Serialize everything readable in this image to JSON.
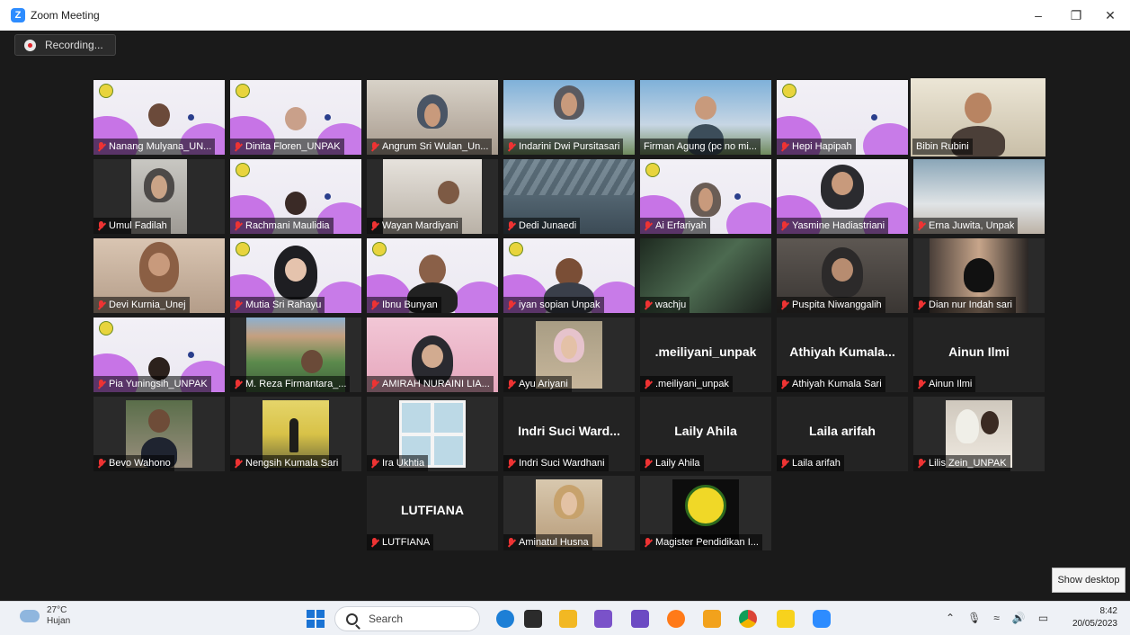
{
  "window": {
    "title": "Zoom Meeting",
    "minimize_icon": "minimize-icon",
    "maximize_icon": "restore-icon",
    "close_icon": "close-icon"
  },
  "recording": {
    "label": "Recording..."
  },
  "participants": [
    {
      "name": "Nanang Mulyana_UN...",
      "muted": true
    },
    {
      "name": "Dinita Floren_UNPAK",
      "muted": true
    },
    {
      "name": "Angrum Sri Wulan_Un...",
      "muted": true
    },
    {
      "name": "Indarini Dwi Pursitasari",
      "muted": true
    },
    {
      "name": "Firman Agung (pc no mi...",
      "muted": false
    },
    {
      "name": "Hepi Hapipah",
      "muted": true
    },
    {
      "name": "Bibin Rubini",
      "muted": false,
      "active_speaker": true
    },
    {
      "name": "Umul Fadilah",
      "muted": true
    },
    {
      "name": "Rachmani Maulidia",
      "muted": true
    },
    {
      "name": "Wayan Mardiyani",
      "muted": true
    },
    {
      "name": "Dedi Junaedi",
      "muted": true
    },
    {
      "name": "Ai Erfariyah",
      "muted": true
    },
    {
      "name": "Yasmine Hadiastriani",
      "muted": true
    },
    {
      "name": "Erna Juwita, Unpak",
      "muted": true
    },
    {
      "name": "Devi Kurnia_Unej",
      "muted": true
    },
    {
      "name": "Mutia Sri Rahayu",
      "muted": true
    },
    {
      "name": "Ibnu Bunyan",
      "muted": true
    },
    {
      "name": "iyan sopian Unpak",
      "muted": true
    },
    {
      "name": "wachju",
      "muted": true
    },
    {
      "name": "Puspita Niwanggalih",
      "muted": true
    },
    {
      "name": "Dian nur Indah sari",
      "muted": true
    },
    {
      "name": "Pia Yuningsih_UNPAK",
      "muted": true
    },
    {
      "name": "M. Reza Firmantara_...",
      "muted": true
    },
    {
      "name": "AMIRAH NURAINI LIA...",
      "muted": true
    },
    {
      "name": "Ayu Ariyani",
      "muted": true
    },
    {
      "name": ".meiliyani_unpak",
      "muted": true,
      "display_name": ".meiliyani_unpak"
    },
    {
      "name": "Athiyah Kumala Sari",
      "muted": true,
      "display_name": "Athiyah  Kumala..."
    },
    {
      "name": "Ainun Ilmi",
      "muted": true,
      "display_name": "Ainun Ilmi"
    },
    {
      "name": "Bevo Wahono",
      "muted": true
    },
    {
      "name": "Nengsih Kumala Sari",
      "muted": true
    },
    {
      "name": "Ira Ukhtia",
      "muted": true
    },
    {
      "name": "Indri Suci Wardhani",
      "muted": true,
      "display_name": "Indri  Suci  Ward..."
    },
    {
      "name": "Laily Ahila",
      "muted": true,
      "display_name": "Laily Ahila"
    },
    {
      "name": "Laila arifah",
      "muted": true,
      "display_name": "Laila arifah"
    },
    {
      "name": "Lilis Zein_UNPAK",
      "muted": true
    },
    {
      "name": "LUTFIANA",
      "muted": true,
      "display_name": "LUTFIANA"
    },
    {
      "name": "Aminatul Husna",
      "muted": true
    },
    {
      "name": "Magister Pendidikan I...",
      "muted": true
    }
  ],
  "show_desktop": {
    "label": "Show desktop"
  },
  "taskbar": {
    "weather_temp": "27°C",
    "weather_desc": "Hujan",
    "search_placeholder": "Search",
    "time": "8:42",
    "date": "20/05/2023",
    "apps": [
      "bing-chat-icon",
      "task-view-icon",
      "file-explorer-icon",
      "photos-icon",
      "photo-editor-icon",
      "firefox-icon",
      "network-app-icon",
      "chrome-icon",
      "sticky-notes-icon",
      "zoom-icon"
    ]
  },
  "colors": {
    "accent": "#2d8cff",
    "active_outline": "#c9d84a",
    "muted_mic": "#e33333",
    "meeting_bg": "#1a1a1a"
  }
}
